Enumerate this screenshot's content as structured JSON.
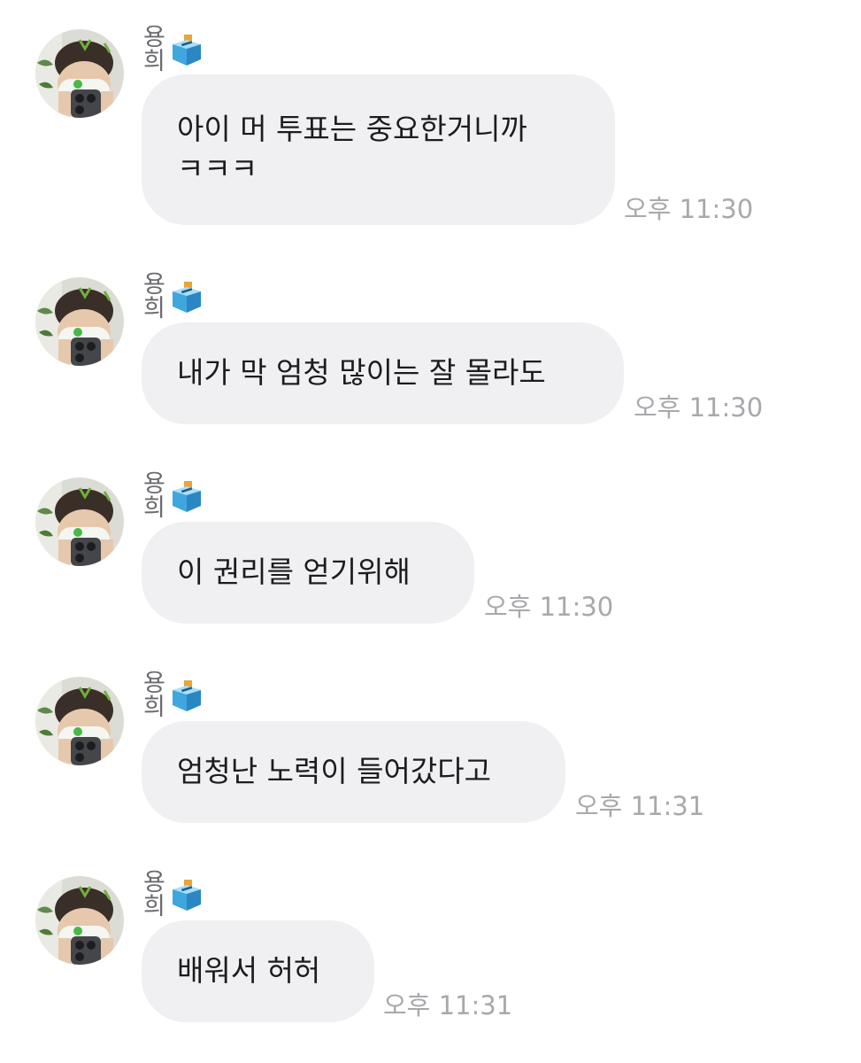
{
  "conversation": {
    "messages": [
      {
        "sender": "용희",
        "sender_icon": "ballot-box-icon",
        "text": "아이 머 투표는 중요한거니까\nㅋㅋㅋ",
        "time": "오후 11:30"
      },
      {
        "sender": "용희",
        "sender_icon": "ballot-box-icon",
        "text": "내가 막 엄청 많이는 잘 몰라도",
        "time": "오후 11:30"
      },
      {
        "sender": "용희",
        "sender_icon": "ballot-box-icon",
        "text": "이 권리를 얻기위해",
        "time": "오후 11:30"
      },
      {
        "sender": "용희",
        "sender_icon": "ballot-box-icon",
        "text": "엄청난 노력이 들어갔다고",
        "time": "오후 11:31"
      },
      {
        "sender": "용희",
        "sender_icon": "ballot-box-icon",
        "text": "배워서 허허",
        "time": "오후 11:31"
      }
    ]
  },
  "colors": {
    "background": "#ffffff",
    "bubble": "#f0f0f3",
    "message_text": "#1c1c1e",
    "sender_text": "#6b6b70",
    "timestamp_text": "#a8a8ad"
  }
}
